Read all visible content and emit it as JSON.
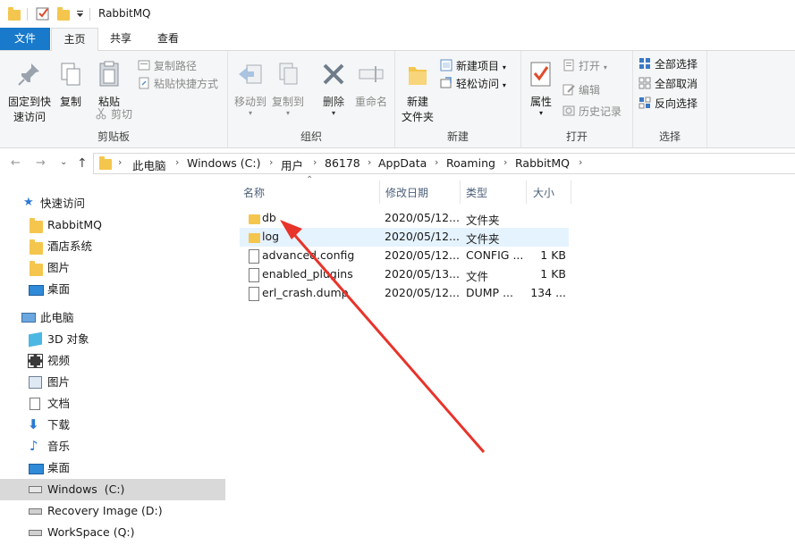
{
  "window": {
    "title": "RabbitMQ"
  },
  "tabs": {
    "file": "文件",
    "home": "主页",
    "share": "共享",
    "view": "查看"
  },
  "ribbon": {
    "clipboard": {
      "label": "剪贴板",
      "pin": "固定到快\n速访问",
      "copy": "复制",
      "paste": "粘贴",
      "copy_path": "复制路径",
      "paste_shortcut": "粘贴快捷方式",
      "cut": "剪切"
    },
    "organize": {
      "label": "组织",
      "move_to": "移动到",
      "copy_to": "复制到",
      "delete": "删除",
      "rename": "重命名"
    },
    "new": {
      "label": "新建",
      "new_folder": "新建\n文件夹",
      "new_item": "新建项目",
      "easy_access": "轻松访问"
    },
    "open": {
      "label": "打开",
      "properties": "属性",
      "open": "打开",
      "edit": "编辑",
      "history": "历史记录"
    },
    "select": {
      "label": "选择",
      "select_all": "全部选择",
      "select_none": "全部取消",
      "invert": "反向选择"
    }
  },
  "address": {
    "crumbs": [
      "此电脑",
      "Windows (C:)",
      "用户",
      "86178",
      "AppData",
      "Roaming",
      "RabbitMQ"
    ]
  },
  "nav": {
    "quick_access": "快速访问",
    "quick_items": [
      "RabbitMQ",
      "酒店系统",
      "图片",
      "桌面"
    ],
    "this_pc": "此电脑",
    "pc_items": [
      "3D 对象",
      "视频",
      "图片",
      "文档",
      "下载",
      "音乐",
      "桌面",
      "Windows  (C:)",
      "Recovery Image (D:)",
      "WorkSpace (Q:)"
    ]
  },
  "columns": {
    "name": "名称",
    "date": "修改日期",
    "type": "类型",
    "size": "大小"
  },
  "files": [
    {
      "name": "db",
      "date": "2020/05/12...",
      "type": "文件夹",
      "size": "",
      "icon": "folder-icon"
    },
    {
      "name": "log",
      "date": "2020/05/12...",
      "type": "文件夹",
      "size": "",
      "icon": "folder-icon"
    },
    {
      "name": "advanced.config",
      "date": "2020/05/12...",
      "type": "CONFIG ...",
      "size": "1 KB",
      "icon": "file-icon"
    },
    {
      "name": "enabled_plugins",
      "date": "2020/05/13...",
      "type": "文件",
      "size": "1 KB",
      "icon": "file-icon"
    },
    {
      "name": "erl_crash.dump",
      "date": "2020/05/12...",
      "type": "DUMP ...",
      "size": "134 ...",
      "icon": "file-icon"
    }
  ],
  "colors": {
    "accent": "#1979ca",
    "folder": "#f4c64d",
    "selection": "#e5f3ff",
    "annotation_arrow": "#e8332a"
  }
}
